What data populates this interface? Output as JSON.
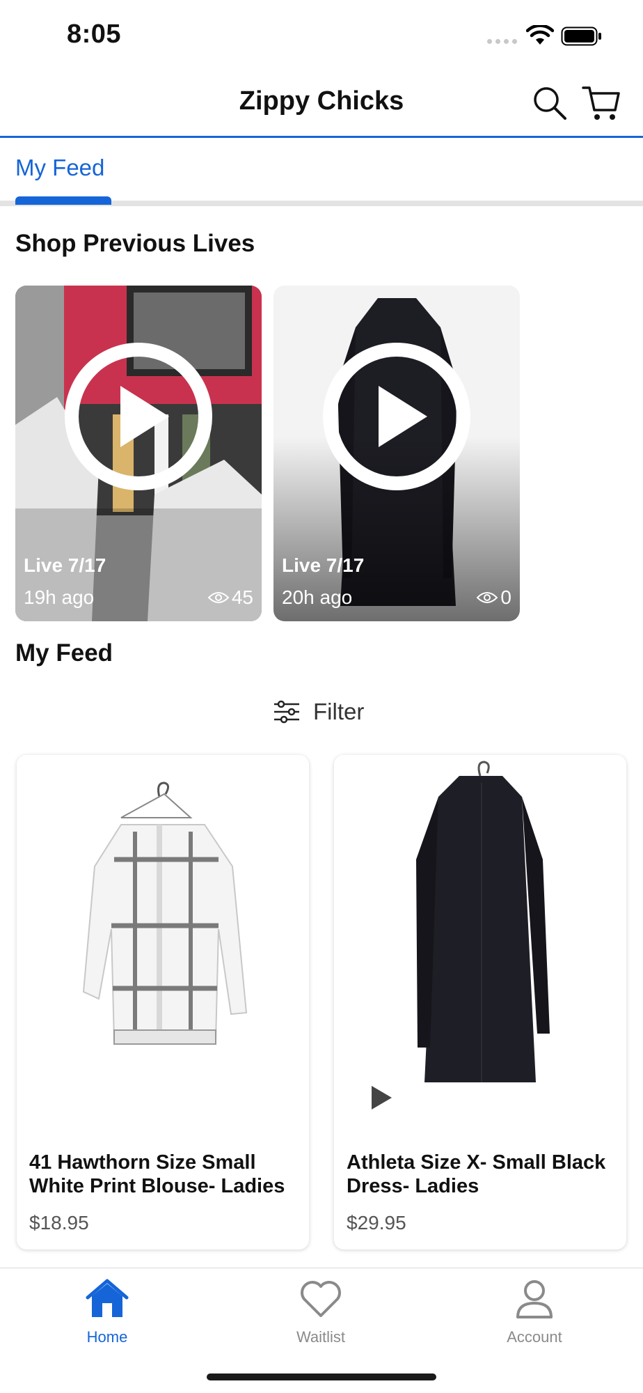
{
  "status_bar": {
    "time": "8:05"
  },
  "header": {
    "title": "Zippy Chicks"
  },
  "tabs": [
    {
      "label": "My Feed",
      "active": true
    }
  ],
  "sections": {
    "previous_lives_title": "Shop Previous Lives",
    "my_feed_title": "My Feed"
  },
  "lives": [
    {
      "label": "Live 7/17",
      "ago": "19h ago",
      "views": "45"
    },
    {
      "label": "Live 7/17",
      "ago": "20h ago",
      "views": "0"
    }
  ],
  "filter": {
    "label": "Filter"
  },
  "products": [
    {
      "name": "41 Hawthorn Size Small White Print Blouse- Ladies",
      "price": "$18.95"
    },
    {
      "name": "Athleta Size X- Small Black Dress- Ladies",
      "price": "$29.95"
    }
  ],
  "bottom_nav": [
    {
      "label": "Home",
      "icon": "home-icon",
      "active": true
    },
    {
      "label": "Waitlist",
      "icon": "heart-icon",
      "active": false
    },
    {
      "label": "Account",
      "icon": "person-icon",
      "active": false
    }
  ],
  "colors": {
    "accent": "#1565d8",
    "inactive": "#8a8a8a"
  }
}
